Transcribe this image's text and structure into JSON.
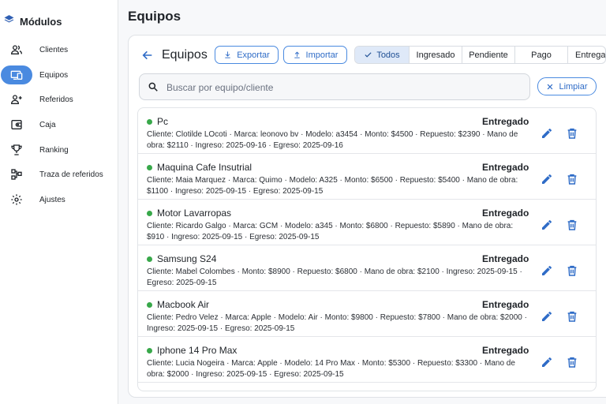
{
  "sidebar": {
    "brand": "Módulos",
    "items": [
      {
        "label": "Clientes",
        "icon": "users-icon"
      },
      {
        "label": "Equipos",
        "icon": "devices-icon",
        "active": true
      },
      {
        "label": "Referidos",
        "icon": "person-add-icon"
      },
      {
        "label": "Caja",
        "icon": "wallet-icon"
      },
      {
        "label": "Ranking",
        "icon": "trophy-icon"
      },
      {
        "label": "Traza de referidos",
        "icon": "hierarchy-icon"
      },
      {
        "label": "Ajustes",
        "icon": "gear-icon"
      }
    ]
  },
  "page": {
    "title": "Equipos"
  },
  "toolbar": {
    "title": "Equipos",
    "export_label": "Exportar",
    "import_label": "Importar"
  },
  "filters": {
    "options": [
      "Todos",
      "Ingresado",
      "Pendiente",
      "Pago",
      "Entregado"
    ],
    "selected": "Todos"
  },
  "search": {
    "placeholder": "Buscar por equipo/cliente",
    "value": "",
    "clear_label": "Limpiar"
  },
  "colors": {
    "accent": "#2f6cc7",
    "active_nav": "#4a8ae0",
    "status_dot": "#38a84a",
    "selected_filter_bg": "#dfe9f8"
  },
  "equipos": [
    {
      "name": "Pc",
      "status": "Entregado",
      "details": "Cliente: Clotilde LOcoti · Marca: leonovo bv · Modelo: a3454 · Monto: $4500 · Repuesto: $2390 · Mano de obra: $2110 · Ingreso: 2025-09-16 · Egreso: 2025-09-16"
    },
    {
      "name": "Maquina Cafe Insutrial",
      "status": "Entregado",
      "details": "Cliente: Maia Marquez · Marca: Quimo · Modelo: A325 · Monto: $6500 · Repuesto: $5400 · Mano de obra: $1100 · Ingreso: 2025-09-15 · Egreso: 2025-09-15"
    },
    {
      "name": "Motor Lavarropas",
      "status": "Entregado",
      "details": "Cliente: Ricardo Galgo · Marca: GCM · Modelo: a345 · Monto: $6800 · Repuesto: $5890 · Mano de obra: $910 · Ingreso: 2025-09-15 · Egreso: 2025-09-15"
    },
    {
      "name": "Samsung S24",
      "status": "Entregado",
      "details": "Cliente: Mabel Colombes · Monto: $8900 · Repuesto: $6800 · Mano de obra: $2100 · Ingreso: 2025-09-15 · Egreso: 2025-09-15"
    },
    {
      "name": "Macbook Air",
      "status": "Entregado",
      "details": "Cliente: Pedro Velez · Marca: Apple · Modelo: Air · Monto: $9800 · Repuesto: $7800 · Mano de obra: $2000 · Ingreso: 2025-09-15 · Egreso: 2025-09-15"
    },
    {
      "name": "Iphone 14 Pro Max",
      "status": "Entregado",
      "details": "Cliente: Lucia Nogeira · Marca: Apple · Modelo: 14 Pro Max · Monto: $5300 · Repuesto: $3300 · Mano de obra: $2000 · Ingreso: 2025-09-15 · Egreso: 2025-09-15"
    }
  ]
}
